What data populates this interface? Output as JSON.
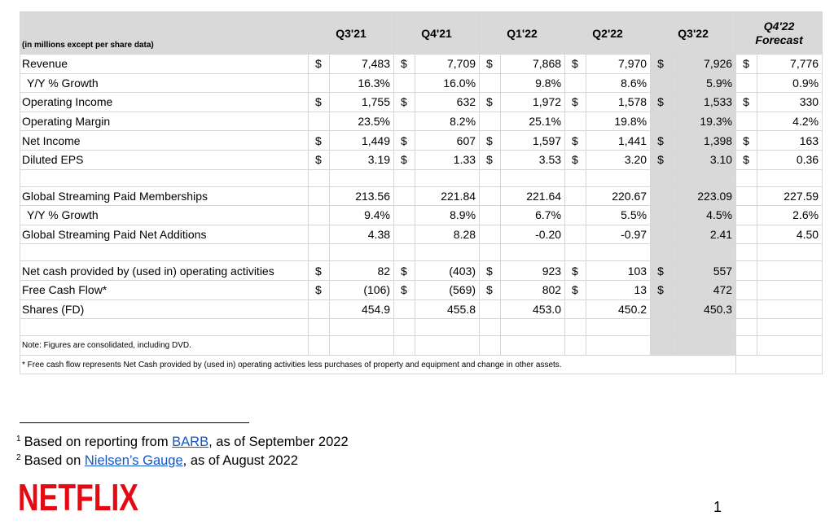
{
  "table": {
    "units_label": "(in millions except per share data)",
    "columns": [
      "Q3'21",
      "Q4'21",
      "Q1'22",
      "Q2'22",
      "Q3'22"
    ],
    "forecast_column": [
      "Q4'22",
      "Forecast"
    ],
    "rows": [
      {
        "label": "Revenue",
        "dollar": [
          "$",
          "$",
          "$",
          "$",
          "$",
          "$"
        ],
        "values": [
          "7,483",
          "7,709",
          "7,868",
          "7,970",
          "7,926",
          "7,776"
        ]
      },
      {
        "label": "Y/Y % Growth",
        "values": [
          "16.3%",
          "16.0%",
          "9.8%",
          "8.6%",
          "5.9%",
          "0.9%"
        ]
      },
      {
        "label": "Operating Income",
        "dollar": [
          "$",
          "$",
          "$",
          "$",
          "$",
          "$"
        ],
        "values": [
          "1,755",
          "632",
          "1,972",
          "1,578",
          "1,533",
          "330"
        ]
      },
      {
        "label": "Operating Margin",
        "values": [
          "23.5%",
          "8.2%",
          "25.1%",
          "19.8%",
          "19.3%",
          "4.2%"
        ]
      },
      {
        "label": "Net Income",
        "dollar": [
          "$",
          "$",
          "$",
          "$",
          "$",
          "$"
        ],
        "values": [
          "1,449",
          "607",
          "1,597",
          "1,441",
          "1,398",
          "163"
        ]
      },
      {
        "label": "Diluted EPS",
        "dollar": [
          "$",
          "$",
          "$",
          "$",
          "$",
          "$"
        ],
        "values": [
          "3.19",
          "1.33",
          "3.53",
          "3.20",
          "3.10",
          "0.36"
        ]
      },
      {
        "label": "Global Streaming Paid Memberships",
        "values": [
          "213.56",
          "221.84",
          "221.64",
          "220.67",
          "223.09",
          "227.59"
        ]
      },
      {
        "label": "Y/Y % Growth",
        "values": [
          "9.4%",
          "8.9%",
          "6.7%",
          "5.5%",
          "4.5%",
          "2.6%"
        ]
      },
      {
        "label": "Global Streaming Paid Net Additions",
        "values": [
          "4.38",
          "8.28",
          "-0.20",
          "-0.97",
          "2.41",
          "4.50"
        ]
      },
      {
        "label": "Net cash provided by (used in) operating activities",
        "dollar": [
          "$",
          "$",
          "$",
          "$",
          "$"
        ],
        "values": [
          "82",
          "(403)",
          "923",
          "103",
          "557",
          ""
        ]
      },
      {
        "label": "Free Cash Flow*",
        "dollar": [
          "$",
          "$",
          "$",
          "$",
          "$"
        ],
        "values": [
          "(106)",
          "(569)",
          "802",
          "13",
          "472",
          ""
        ]
      },
      {
        "label": "Shares (FD)",
        "values": [
          "454.9",
          "455.8",
          "453.0",
          "450.2",
          "450.3",
          ""
        ]
      }
    ],
    "notes": [
      "Note: Figures are consolidated, including DVD.",
      "* Free cash flow represents Net Cash provided by (used in) operating activities less purchases of property and equipment and change in other assets."
    ]
  },
  "footnotes": [
    {
      "marker": "1",
      "prefix": "Based on reporting from ",
      "link": "BARB",
      "suffix": ", as of September 2022"
    },
    {
      "marker": "2",
      "prefix": "Based on ",
      "link": "Nielsen’s Gauge",
      "suffix": ", as of August 2022"
    }
  ],
  "logo_text": "NETFLIX",
  "logo_color": "#e50914",
  "page_number": "1"
}
